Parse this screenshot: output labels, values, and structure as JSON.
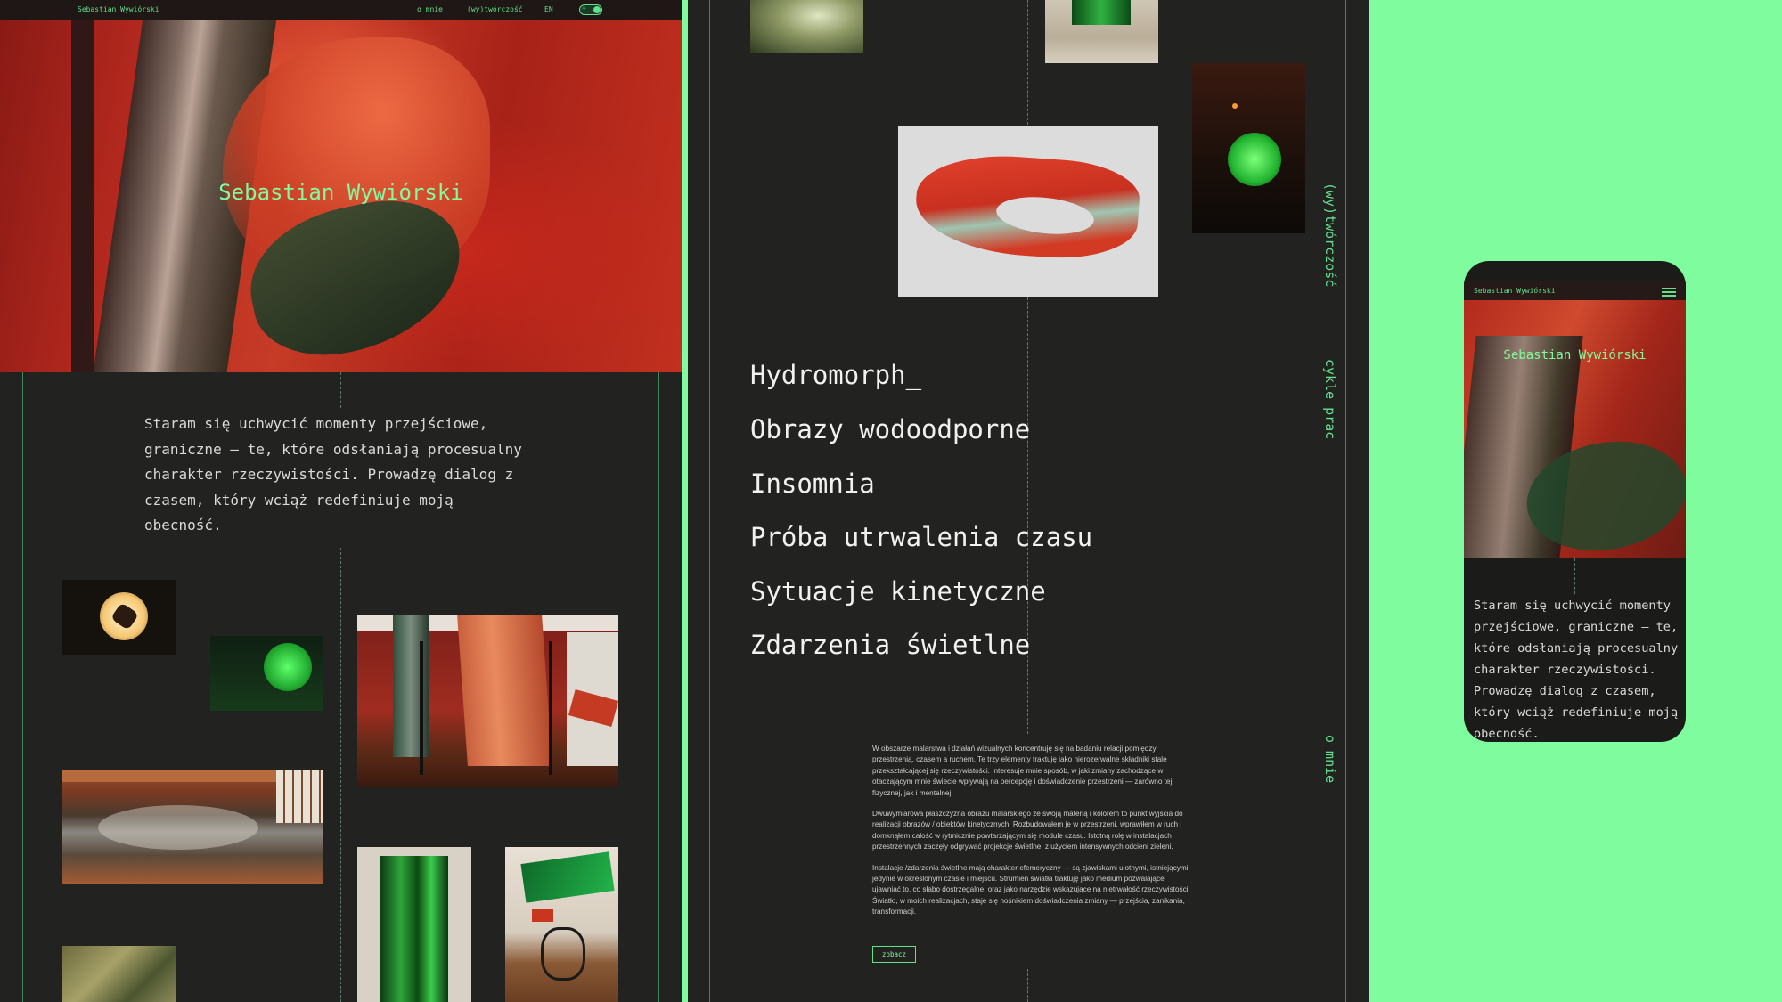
{
  "header": {
    "brand": "Sebastian Wywiórski",
    "nav": [
      "o mnie",
      "(wy)twórczość",
      "EN"
    ],
    "theme_toggle_icons": [
      "sun-icon",
      "moon-icon"
    ]
  },
  "hero": {
    "title": "Sebastian Wywiórski"
  },
  "intro": {
    "text": "Staram się uchwycić momenty przejściowe, graniczne — te, które odsłaniają procesualny charakter rzeczywistości. Prowadzę dialog z czasem, który wciąż redefiniuje moją obecność."
  },
  "works": {
    "items": [
      "Hydromorph_",
      "Obrazy wodoodporne",
      "Insomnia",
      "Próba utrwalenia czasu",
      "Sytuacje kinetyczne",
      "Zdarzenia świetlne"
    ]
  },
  "side_labels": [
    "(wy)twórczość",
    "cykle prac",
    "o mnie"
  ],
  "about": {
    "paragraphs": [
      "W obszarze malarstwa i działań wizualnych koncentruję się na badaniu relacji pomiędzy przestrzenią, czasem a ruchem. Te trzy elementy traktuję jako nierozerwalne składniki stale przekształcającej się rzeczywistości. Interesuje mnie sposób, w jaki zmiany zachodzące w otaczającym mnie świecie wpływają na percepcję i doświadczenie przestrzeni — zarówno tej fizycznej, jak i mentalnej.",
      "Dwuwymiarowa płaszczyzna obrazu malarskiego ze swoją materią i kolorem to punkt wyjścia do realizacji obrazów / obiektów kinetycznych. Rozbudowałem je w przestrzeni, wprawiłem w ruch i domknąłem całość w rytmicznie powtarzającym się module czasu. Istotną rolę w instalacjach przestrzennych zaczęły odgrywać projekcje świetlne, z użyciem intensywnych odcieni zieleni.",
      "Instalacje /zdarzenia świetlne mają charakter efemeryczny — są zjawiskami ulotnymi, istniejącymi jedynie w określonym czasie i miejscu. Strumień światła traktuję jako medium pozwalające ujawniać to, co słabo dostrzegalne, oraz jako narzędzie wskazujące na nietrwałość rzeczywistości. Światło, w moich realizacjach, staje się nośnikiem doświadczenia zmiany — przejścia, zanikania, transformacji."
    ],
    "button_label": "zobacz"
  },
  "mobile": {
    "brand": "Sebastian Wywiórski",
    "title": "Sebastian Wywiórski",
    "intro": "Staram się uchwycić momenty przejściowe, graniczne — te, które odsłaniają procesualny charakter rzeczywistości. Prowadzę dialog z czasem, który wciąż redefiniuje moją obecność.",
    "menu_icon": "hamburger-menu-icon"
  },
  "colors": {
    "accent_green": "#7ffc9d",
    "link_green": "#62e08c",
    "panel_bg": "#222221",
    "hero_red": "#c63b26"
  }
}
